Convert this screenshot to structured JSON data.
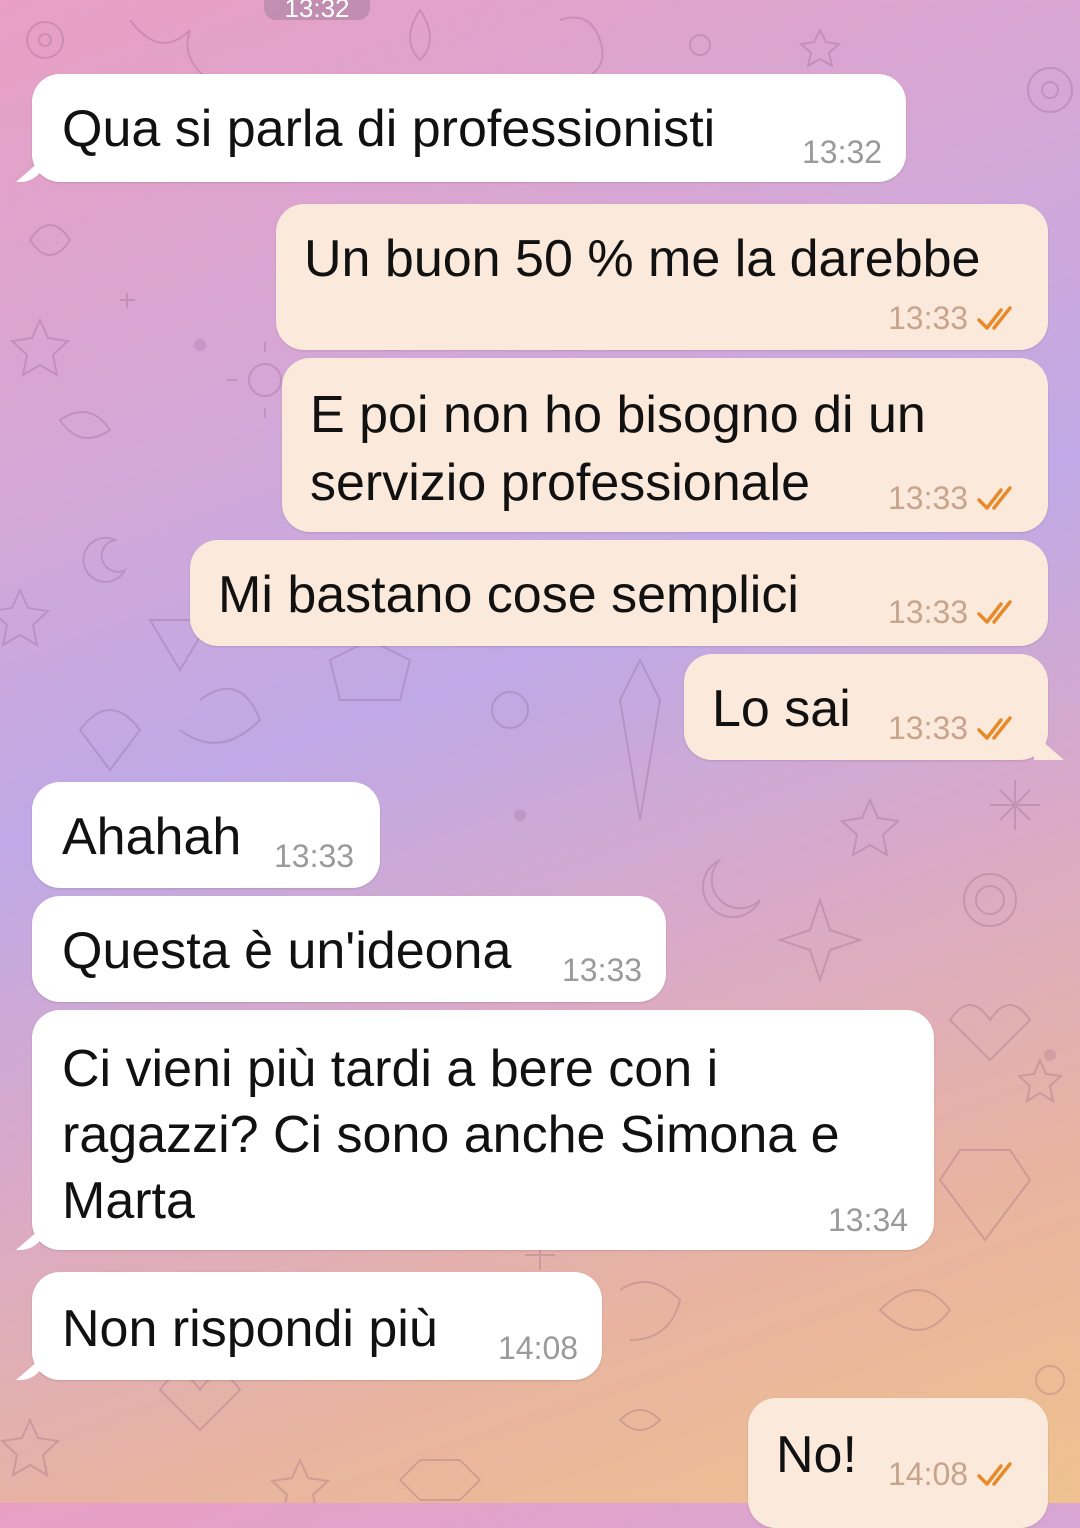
{
  "chat": {
    "date_separator_time": "13:32",
    "messages": [
      {
        "text": "Qua si parla di professionisti",
        "time": "13:32"
      },
      {
        "text": "Un buon 50 % me la darebbe",
        "time": "13:33"
      },
      {
        "line1": "E poi non ho bisogno di un",
        "line2": "servizio professionale",
        "time": "13:33"
      },
      {
        "text": "Mi bastano cose semplici",
        "time": "13:33"
      },
      {
        "text": "Lo sai",
        "time": "13:33"
      },
      {
        "text": "Ahahah",
        "time": "13:33"
      },
      {
        "text": "Questa è un'ideona",
        "time": "13:33"
      },
      {
        "line1": "Ci vieni più tardi a bere con i",
        "line2": "ragazzi? Ci sono anche Simona e",
        "line3": "Marta",
        "time": "13:34"
      },
      {
        "text": "Non rispondi più",
        "time": "14:08"
      },
      {
        "text": "No!",
        "time": "14:08"
      }
    ]
  },
  "theme": {
    "incoming_bubble": "#ffffff",
    "outgoing_bubble": "#fbeadb",
    "read_check": "#e8892a",
    "wallpaper": "pink-purple-orange gradient with unicorn and gem doodles"
  },
  "icons": {
    "read_receipt": "double-check-icon"
  }
}
